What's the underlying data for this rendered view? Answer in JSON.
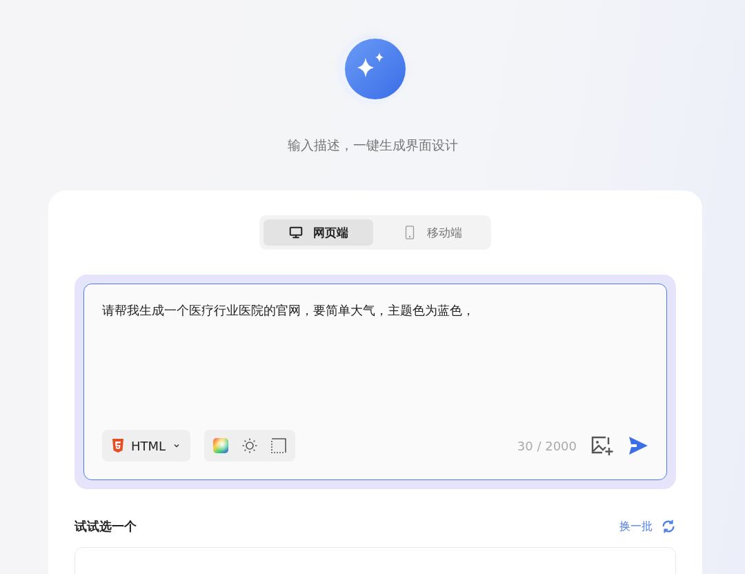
{
  "hero": {
    "subtitle": "输入描述，一键生成界面设计"
  },
  "tabs": [
    {
      "label": "网页端",
      "kind": "desktop",
      "selected": true
    },
    {
      "label": "移动端",
      "kind": "phone",
      "selected": false
    }
  ],
  "prompt": {
    "value": "请帮我生成一个医疗行业医院的官网，要简单大气，主题色为蓝色，",
    "framework": "HTML",
    "counter": "30 / 2000"
  },
  "suggestions": {
    "title": "试试选一个",
    "refresh": "换一批"
  }
}
